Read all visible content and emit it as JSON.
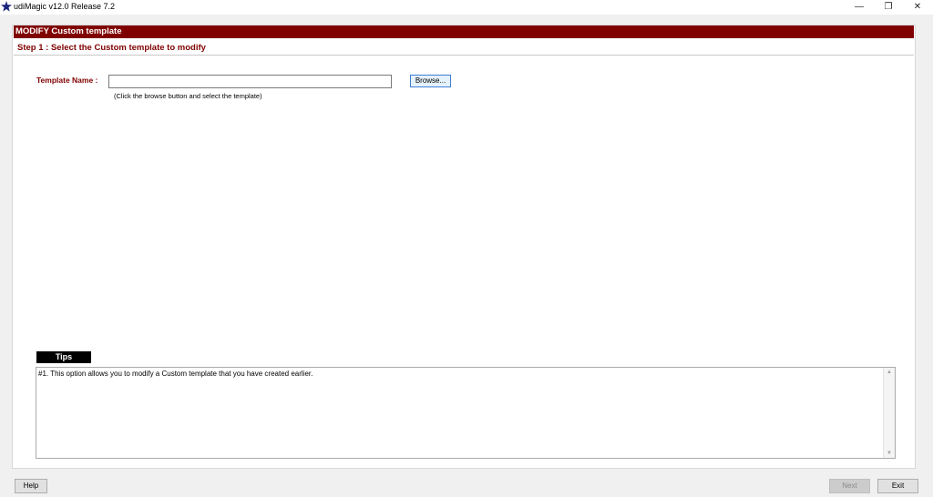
{
  "window": {
    "title": "udiMagic v12.0 Release 7.2",
    "minimize_glyph": "—",
    "maximize_glyph": "❐",
    "close_glyph": "✕",
    "app_icon": "star-logo-icon"
  },
  "header": {
    "title": "MODIFY Custom template"
  },
  "step": {
    "title": "Step 1 : Select the Custom template to modify"
  },
  "template": {
    "label": "Template Name :",
    "value": "",
    "browse_label": "Browse...",
    "hint": "(Click the browse button and select the template)"
  },
  "tips": {
    "label": "Tips",
    "text": "#1. This option allows you to modify a Custom template that you have created earlier."
  },
  "footer": {
    "help_label": "Help",
    "next_label": "Next",
    "exit_label": "Exit"
  },
  "colors": {
    "accent": "#800000",
    "tips_label_bg": "#000000"
  }
}
